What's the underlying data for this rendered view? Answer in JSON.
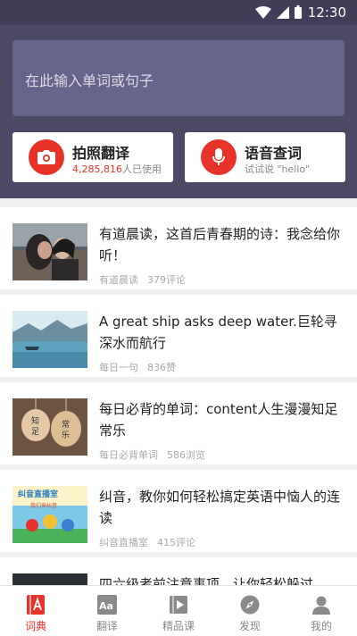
{
  "status_bar": {
    "time": "12:30"
  },
  "search": {
    "placeholder": "在此输入单词或句子"
  },
  "actions": {
    "photo": {
      "title": "拍照翻译",
      "count": "4,285,816",
      "count_suffix": "人已使用"
    },
    "voice": {
      "title": "语音查词",
      "subtitle": "试试说 \"hello\""
    }
  },
  "feed": [
    {
      "title": "有道晨读，这首后青春期的诗：我念给你听！",
      "source": "有道晨读",
      "stat": "379评论"
    },
    {
      "title": "A great ship asks deep water.巨轮寻深水而航行",
      "source": "每日一句",
      "stat": "836赞"
    },
    {
      "title": "每日必背的单词：content人生漫漫知足常乐",
      "source": "每日必背单词",
      "stat": "586浏览",
      "thumb_text": [
        "知",
        "足",
        "常",
        "乐"
      ]
    },
    {
      "title": "纠音，教你如何轻松搞定英语中恼人的连读",
      "source": "纠音直播室",
      "stat": "415评论",
      "thumb_text": [
        "纠音直播室",
        "我们来纠音"
      ]
    },
    {
      "title": "四六级考前注意事项，让你轻松躲过"
    }
  ],
  "tabs": [
    {
      "label": "词典",
      "icon": "dictionary-icon",
      "active": true
    },
    {
      "label": "翻译",
      "icon": "translate-icon"
    },
    {
      "label": "精品课",
      "icon": "course-icon"
    },
    {
      "label": "发现",
      "icon": "compass-icon"
    },
    {
      "label": "我的",
      "icon": "profile-icon"
    }
  ],
  "colors": {
    "accent": "#e8332a",
    "header": "#4b4966",
    "search_box": "#66648a"
  }
}
